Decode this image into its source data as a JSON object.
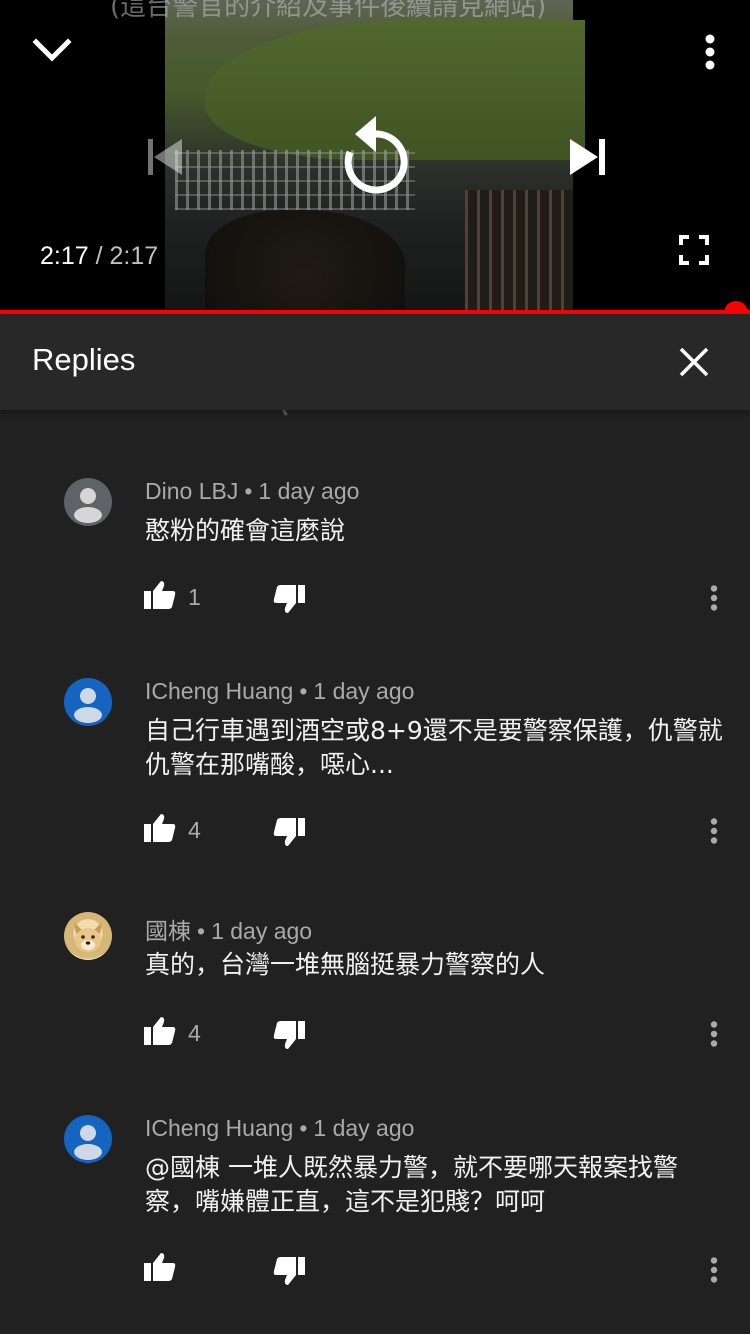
{
  "player": {
    "current_time": "2:17",
    "separator": "/",
    "duration": "2:17",
    "progress_fraction": 1.0,
    "caption_partial": "(這台警官的介紹及事件後續請見網站)",
    "icons": {
      "minimize": "chevron-down-icon",
      "more": "more-vert-icon",
      "previous": "skip-previous-icon",
      "replay": "replay-icon",
      "next": "skip-next-icon",
      "fullscreen": "fullscreen-icon"
    }
  },
  "replies": {
    "title": "Replies",
    "close_icon": "close-icon",
    "items": [
      {
        "author": "Dino LBJ",
        "time": "1 day ago",
        "text": "憨粉的確會這麼說",
        "likes": "1",
        "avatar": "default-grey"
      },
      {
        "author": "ICheng Huang",
        "time": "1 day ago",
        "text": "自己行車遇到酒空或8+9還不是要警察保護，仇警就仇警在那嘴酸，噁心...",
        "likes": "4",
        "avatar": "default-blue"
      },
      {
        "author": "國棟",
        "time": "1 day ago",
        "text": "真的，台灣一堆無腦挺暴力警察的人",
        "likes": "4",
        "avatar": "dog-photo"
      },
      {
        "author": "ICheng Huang",
        "time": "1 day ago",
        "text": "@國棟 一堆人既然暴力警，就不要哪天報案找警察，嘴嫌體正直，這不是犯賤？呵呵",
        "likes": "",
        "avatar": "default-blue"
      }
    ]
  },
  "colors": {
    "background": "#212121",
    "header_background": "#282828",
    "progress": "#ff0000",
    "secondary_text": "#aaaaaa",
    "avatar_grey": "#5f6368",
    "avatar_blue": "#1565c0"
  }
}
